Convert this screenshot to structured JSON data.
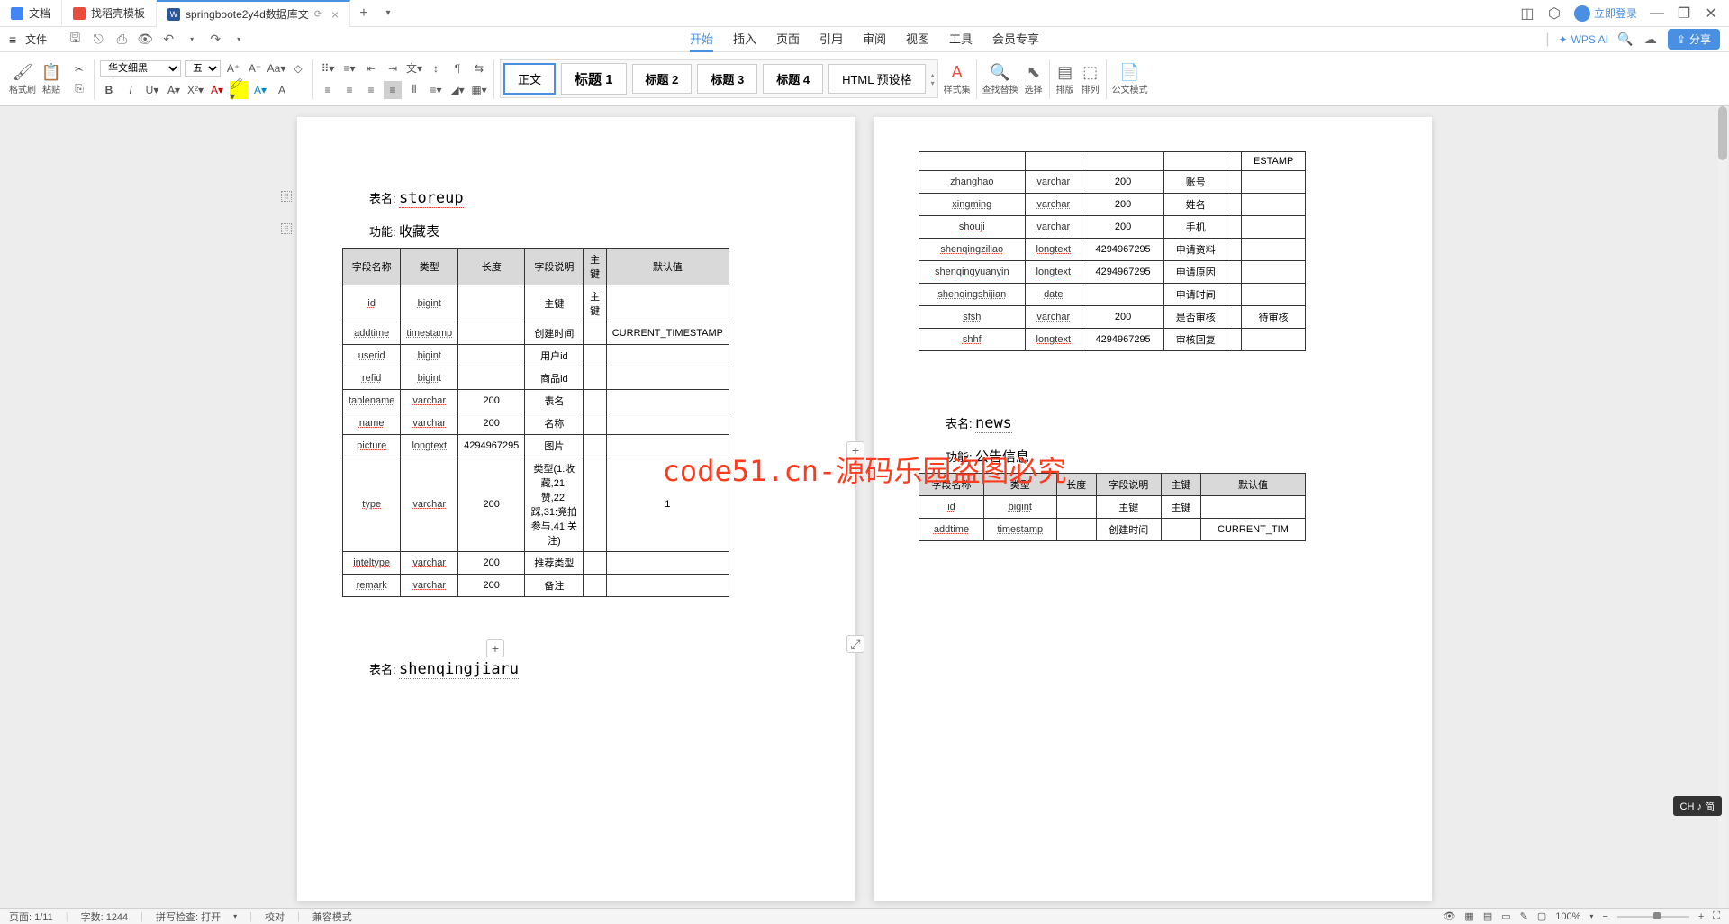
{
  "tabs": [
    {
      "label": "文档",
      "icon": "doc"
    },
    {
      "label": "找稻壳模板",
      "icon": "red"
    },
    {
      "label": "springboote2y4d数据库文",
      "icon": "word",
      "active": true
    }
  ],
  "login_label": "立即登录",
  "file_menu": "文件",
  "menu_tabs": [
    "开始",
    "插入",
    "页面",
    "引用",
    "审阅",
    "视图",
    "工具",
    "会员专享"
  ],
  "active_menu_tab": "开始",
  "wps_ai": "WPS AI",
  "share_label": "分享",
  "ribbon": {
    "format_painter": "格式刷",
    "paste": "粘贴",
    "font_name": "华文细黑",
    "font_size": "五号",
    "styles": [
      "正文",
      "标题 1",
      "标题 2",
      "标题 3",
      "标题 4",
      "HTML 预设格"
    ],
    "style_set": "样式集",
    "find_replace": "查找替换",
    "select": "选择",
    "layout": "排版",
    "arrange": "排列",
    "official_mode": "公文模式"
  },
  "page1": {
    "table_label": "表名:",
    "table_name": "storeup",
    "func_label": "功能:",
    "func_name": "收藏表",
    "headers": [
      "字段名称",
      "类型",
      "长度",
      "字段说明",
      "主键",
      "默认值"
    ],
    "rows": [
      [
        "id",
        "bigint",
        "",
        "主键",
        "主键",
        ""
      ],
      [
        "addtime",
        "timestamp",
        "",
        "创建时间",
        "",
        "CURRENT_TIMESTAMP"
      ],
      [
        "userid",
        "bigint",
        "",
        "用户id",
        "",
        ""
      ],
      [
        "refid",
        "bigint",
        "",
        "商品id",
        "",
        ""
      ],
      [
        "tablename",
        "varchar",
        "200",
        "表名",
        "",
        ""
      ],
      [
        "name",
        "varchar",
        "200",
        "名称",
        "",
        ""
      ],
      [
        "picture",
        "longtext",
        "4294967295",
        "图片",
        "",
        ""
      ],
      [
        "type",
        "varchar",
        "200",
        "类型(1:收藏,21:赞,22:踩,31:竞拍参与,41:关注)",
        "",
        "1"
      ],
      [
        "inteltype",
        "varchar",
        "200",
        "推荐类型",
        "",
        ""
      ],
      [
        "remark",
        "varchar",
        "200",
        "备注",
        "",
        ""
      ]
    ],
    "table2_label": "表名:",
    "table2_name": "shenqingjiaru"
  },
  "page2": {
    "top_cell": "ESTAMP",
    "rows": [
      [
        "zhanghao",
        "varchar",
        "200",
        "账号",
        "",
        ""
      ],
      [
        "xingming",
        "varchar",
        "200",
        "姓名",
        "",
        ""
      ],
      [
        "shouji",
        "varchar",
        "200",
        "手机",
        "",
        ""
      ],
      [
        "shenqingziliao",
        "longtext",
        "4294967295",
        "申请资料",
        "",
        ""
      ],
      [
        "shenqingyuanyin",
        "longtext",
        "4294967295",
        "申请原因",
        "",
        ""
      ],
      [
        "shenqingshijian",
        "date",
        "",
        "申请时间",
        "",
        ""
      ],
      [
        "sfsh",
        "varchar",
        "200",
        "是否审核",
        "",
        "待审核"
      ],
      [
        "shhf",
        "longtext",
        "4294967295",
        "审核回复",
        "",
        ""
      ]
    ],
    "table3_label": "表名:",
    "table3_name": "news",
    "func3_label": "功能:",
    "func3_name": "公告信息",
    "headers": [
      "字段名称",
      "类型",
      "长度",
      "字段说明",
      "主键",
      "默认值"
    ],
    "rows3": [
      [
        "id",
        "bigint",
        "",
        "主键",
        "主键",
        ""
      ],
      [
        "addtime",
        "timestamp",
        "",
        "创建时间",
        "",
        "CURRENT_TIM"
      ]
    ]
  },
  "watermark": "code51.cn-源码乐园盗图必究",
  "status": {
    "page": "页面: 1/11",
    "words": "字数: 1244",
    "spellcheck": "拼写检查: 打开",
    "proof": "校对",
    "compat": "兼容模式",
    "zoom": "100%"
  },
  "ime": "CH ♪ 简"
}
